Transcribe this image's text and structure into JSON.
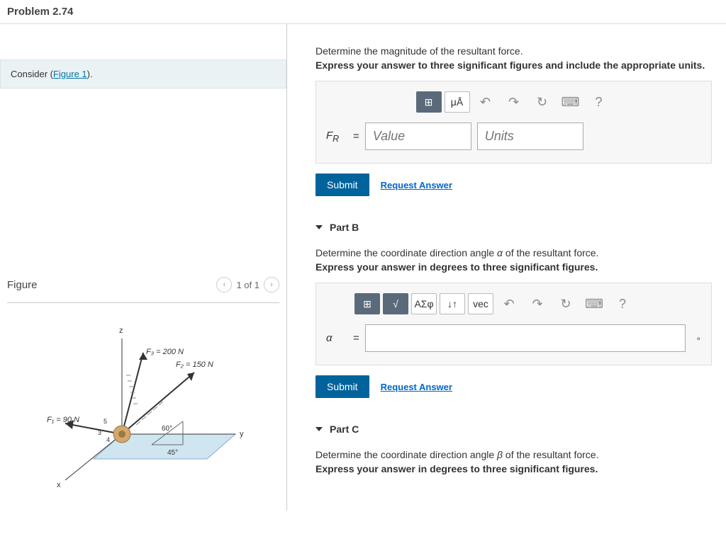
{
  "problem_title": "Problem 2.74",
  "consider_prefix": "Consider (",
  "consider_link": "Figure 1",
  "consider_suffix": ").",
  "figure": {
    "title": "Figure",
    "pager": "1 of 1",
    "forces": {
      "F1": "F₁ = 90 N",
      "F2": "F₂ = 150 N",
      "F3": "F₃ = 200 N",
      "angle60": "60°",
      "angle45": "45°",
      "axis_x": "x",
      "axis_y": "y",
      "axis_z": "z",
      "pie3": "3",
      "pie4": "4",
      "pie5": "5"
    }
  },
  "partA": {
    "prompt": "Determine the magnitude of the resultant force.",
    "instruction": "Express your answer to three significant figures and include the appropriate units.",
    "var_label": "F",
    "var_sub": "R",
    "eq": "=",
    "value_ph": "Value",
    "units_ph": "Units",
    "toolbar": {
      "templates": "⊞",
      "units": "μÅ",
      "undo": "↶",
      "redo": "↷",
      "reset": "↻",
      "keyboard": "⌨",
      "help": "?"
    },
    "submit": "Submit",
    "request": "Request Answer"
  },
  "partB": {
    "header": "Part B",
    "prompt_prefix": "Determine the coordinate direction angle ",
    "prompt_var": "α",
    "prompt_suffix": " of the resultant force.",
    "instruction": "Express your answer in degrees to three significant figures.",
    "var_label": "α",
    "eq": "=",
    "unit_suffix": "∘",
    "toolbar": {
      "templates": "⊞",
      "sqrt": "√",
      "greek": "ΑΣφ",
      "updown": "↓↑",
      "vec": "vec",
      "undo": "↶",
      "redo": "↷",
      "reset": "↻",
      "keyboard": "⌨",
      "help": "?"
    },
    "submit": "Submit",
    "request": "Request Answer"
  },
  "partC": {
    "header": "Part C",
    "prompt_prefix": "Determine the coordinate direction angle ",
    "prompt_var": "β",
    "prompt_suffix": " of the resultant force.",
    "instruction": "Express your answer in degrees to three significant figures."
  }
}
